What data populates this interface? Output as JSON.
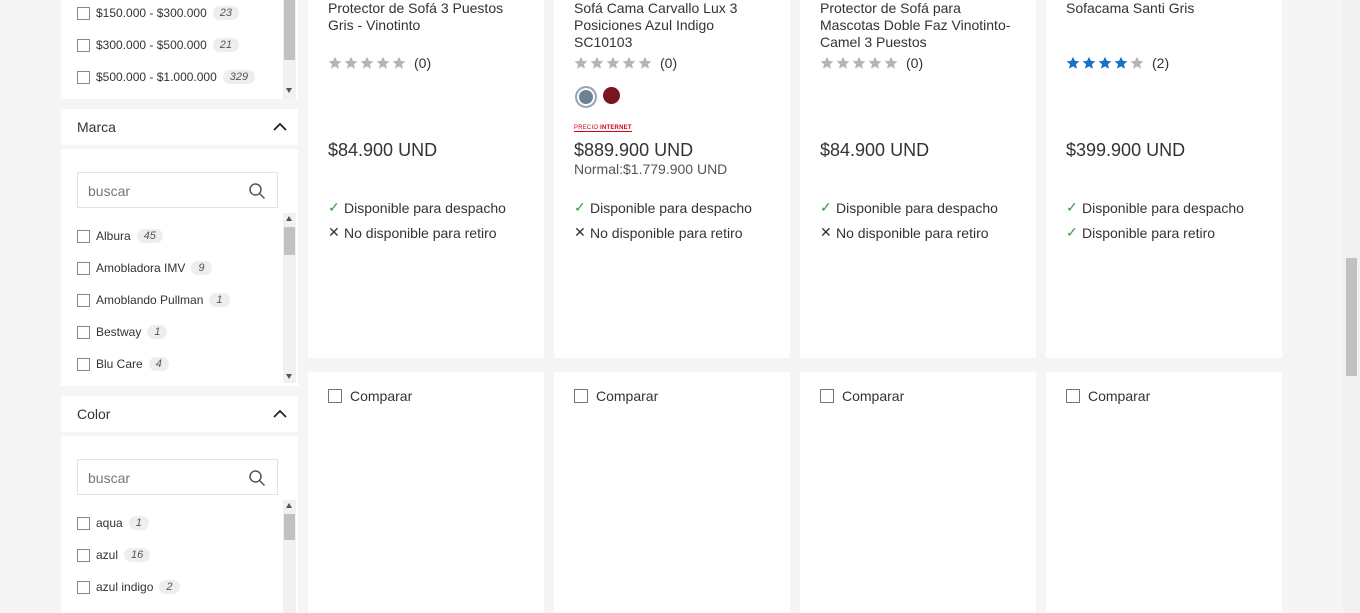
{
  "filters": {
    "price": {
      "items": [
        {
          "label": "$150.000 - $300.000",
          "count": "23"
        },
        {
          "label": "$300.000 - $500.000",
          "count": "21"
        },
        {
          "label": "$500.000 - $1.000.000",
          "count": "329"
        }
      ]
    },
    "brand": {
      "title": "Marca",
      "search_placeholder": "buscar",
      "items": [
        {
          "label": "Albura",
          "count": "45"
        },
        {
          "label": "Amobladora IMV",
          "count": "9"
        },
        {
          "label": "Amoblando Pullman",
          "count": "1"
        },
        {
          "label": "Bestway",
          "count": "1"
        },
        {
          "label": "Blu Care",
          "count": "4"
        }
      ]
    },
    "color": {
      "title": "Color",
      "search_placeholder": "buscar",
      "items": [
        {
          "label": "aqua",
          "count": "1"
        },
        {
          "label": "azul",
          "count": "16"
        },
        {
          "label": "azul indigo",
          "count": "2"
        }
      ]
    }
  },
  "products": [
    {
      "name": "Protector de Sofá 3 Puestos Gris - Vinotinto",
      "rating": 0,
      "reviews": "(0)",
      "price": "$84.900 UND",
      "delivery": "Disponible para despacho",
      "pickup": "No disponible para retiro"
    },
    {
      "name": "Sofá Cama Carvallo Lux 3 Posiciones Azul Indigo SC10103",
      "rating": 0,
      "reviews": "(0)",
      "swatches": [
        "#6e8296",
        "#7a1420"
      ],
      "badge_small": "PRECIO",
      "badge_bold": "INTERNET",
      "price": "$889.900 UND",
      "normal_price": "Normal:$1.779.900 UND",
      "delivery": "Disponible para despacho",
      "pickup": "No disponible para retiro"
    },
    {
      "name": "Protector de Sofá para Mascotas Doble Faz Vinotinto-Camel 3 Puestos",
      "rating": 0,
      "reviews": "(0)",
      "price": "$84.900 UND",
      "delivery": "Disponible para despacho",
      "pickup": "No disponible para retiro"
    },
    {
      "name": "Sofacama Santi Gris",
      "rating": 4,
      "reviews": "(2)",
      "price": "$399.900 UND",
      "delivery": "Disponible para despacho",
      "pickup": "Disponible para retiro"
    }
  ],
  "compare_label": "Comparar",
  "colors": {
    "star_filled": "#1a73c8",
    "star_empty": "#b5b5b5",
    "available": "#3a9c3a",
    "badge": "#d0021b"
  }
}
